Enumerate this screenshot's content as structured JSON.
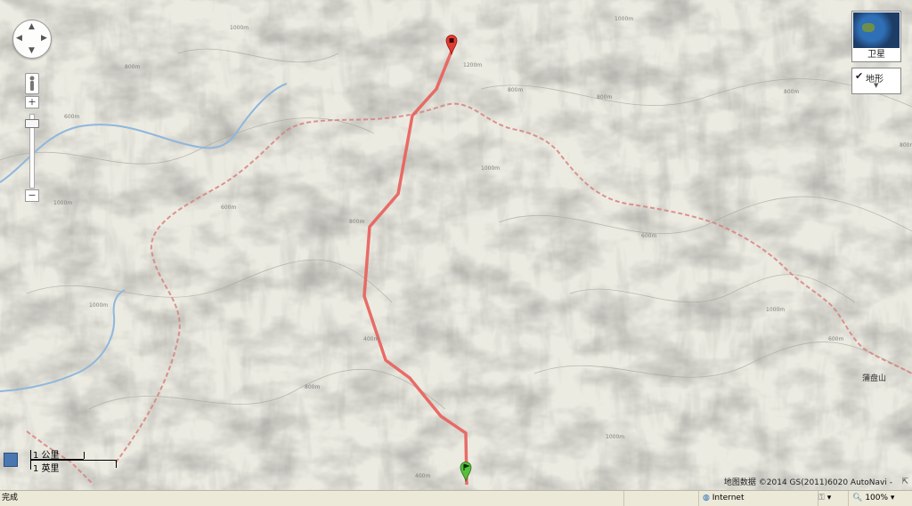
{
  "map": {
    "type_control": {
      "satellite_label": "卫星",
      "terrain_label": "地形",
      "terrain_checked_icon": "checkmark-icon",
      "dropdown_icon": "chevron-down-icon"
    },
    "zoom_control": {
      "zoom_in": "+",
      "zoom_out": "−",
      "pegman_icon": "pegman-icon"
    },
    "pan_control": {
      "up": "▲",
      "down": "▼",
      "left": "◀",
      "right": "▶"
    },
    "scale": {
      "km_label": "1 公里",
      "mile_label": "1 英里"
    },
    "place_label": "蒲盘山",
    "attribution": "地图数据 ©2014 GS(2011)6020 AutoNavi -",
    "contour_labels": [
      "1000m",
      "1200m",
      "1000m",
      "800m",
      "800m",
      "800m",
      "1000m",
      "1000m",
      "800m",
      "600m",
      "1000m",
      "400m",
      "600m",
      "600m",
      "800m",
      "1000m",
      "400m",
      "600m",
      "1000m",
      "800m",
      "800m"
    ],
    "markers": {
      "start_icon": "green-flag-marker-icon",
      "end_icon": "red-end-marker-icon"
    },
    "colors": {
      "route": "#e8615c",
      "river": "#8fb7dc",
      "boundary": "#d7837e",
      "start_marker": "#55c03b",
      "end_marker": "#e23b32"
    }
  },
  "status_bar": {
    "left_text": "完成",
    "zone_label": "Internet",
    "zone_icon": "globe-icon",
    "zoom_text": "100%",
    "zoom_icon": "magnifier-icon"
  }
}
